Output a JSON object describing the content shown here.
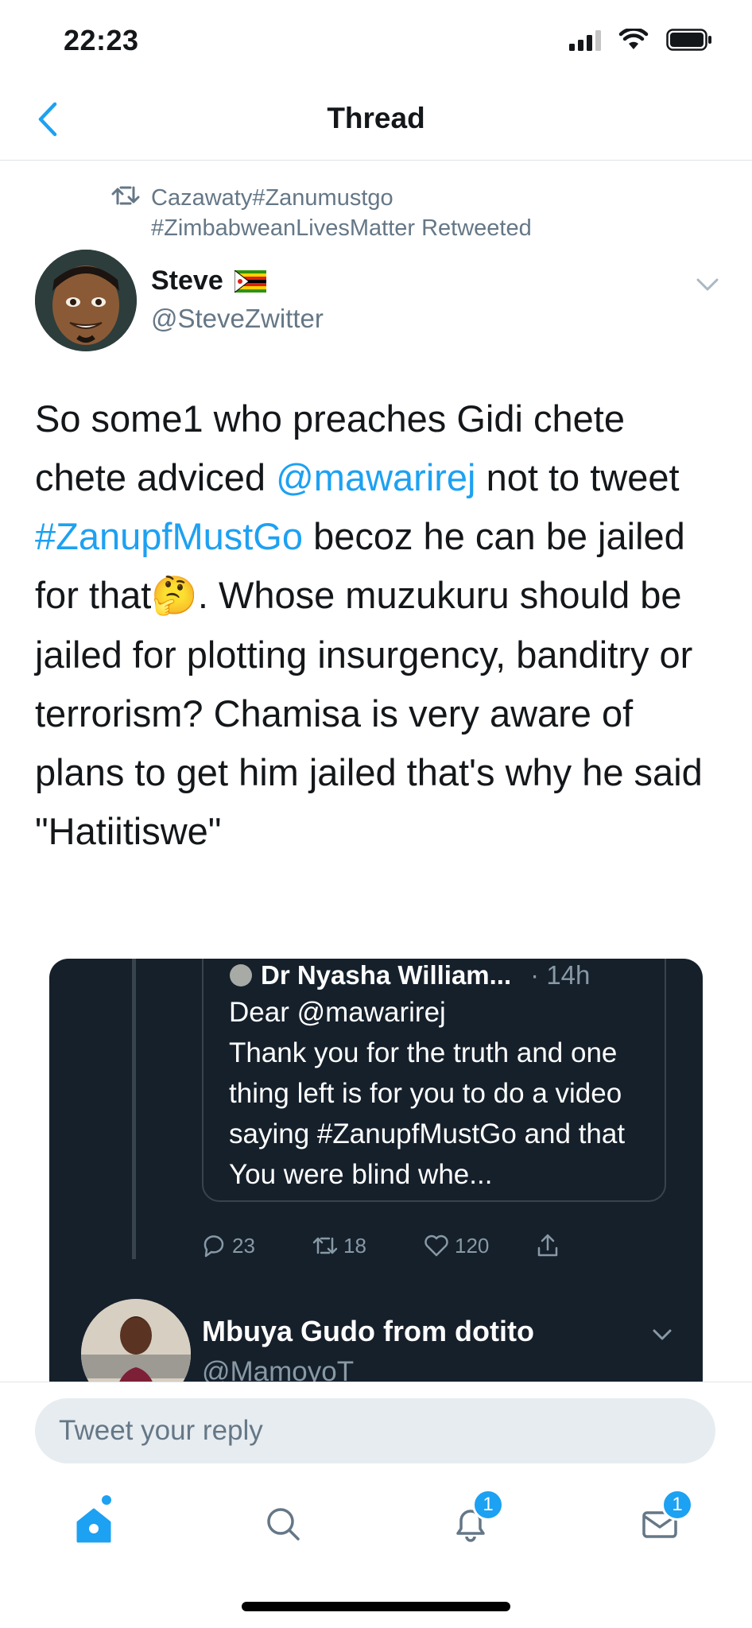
{
  "status_bar": {
    "time": "22:23"
  },
  "header": {
    "title": "Thread"
  },
  "retweet_context": {
    "text": "Cazawaty#Zanumustgo #ZimbabweanLivesMatter Retweeted"
  },
  "tweet": {
    "author_name": "Steve",
    "author_flag": "🇿🇼",
    "author_handle": "@SteveZwitter",
    "body": {
      "p1": "So some1 who preaches Gidi chete chete adviced ",
      "mention": "@mawarirej",
      "p2": " not to tweet ",
      "hashtag": "#ZanupfMustGo",
      "p3": " becoz he can be jailed for that",
      "emoji": "🤔",
      "p4": ". Whose muzukuru should be jailed for plotting insurgency, banditry or terrorism? Chamisa is very aware of plans to get him jailed that's why he said \"Hatiitiswe\""
    }
  },
  "embedded_image": {
    "quoted_author": "Dr Nyasha William...",
    "quoted_time": "· 14h",
    "quoted_text": "Dear @mawarirej\nThank you for the truth and one thing left is for you to do a video saying #ZanupfMustGo and that You were blind whe...",
    "actions": {
      "replies": "23",
      "retweets": "18",
      "likes": "120"
    },
    "reply_author_name": "Mbuya Gudo from dotito",
    "reply_author_handle": "@MamoyoT"
  },
  "reply_input": {
    "placeholder": "Tweet your reply",
    "value": ""
  },
  "tabbar": {
    "notifications_badge": "1",
    "messages_badge": "1"
  },
  "colors": {
    "accent": "#1da1f2",
    "secondary_text": "#657786",
    "embed_bg": "#15202b"
  }
}
